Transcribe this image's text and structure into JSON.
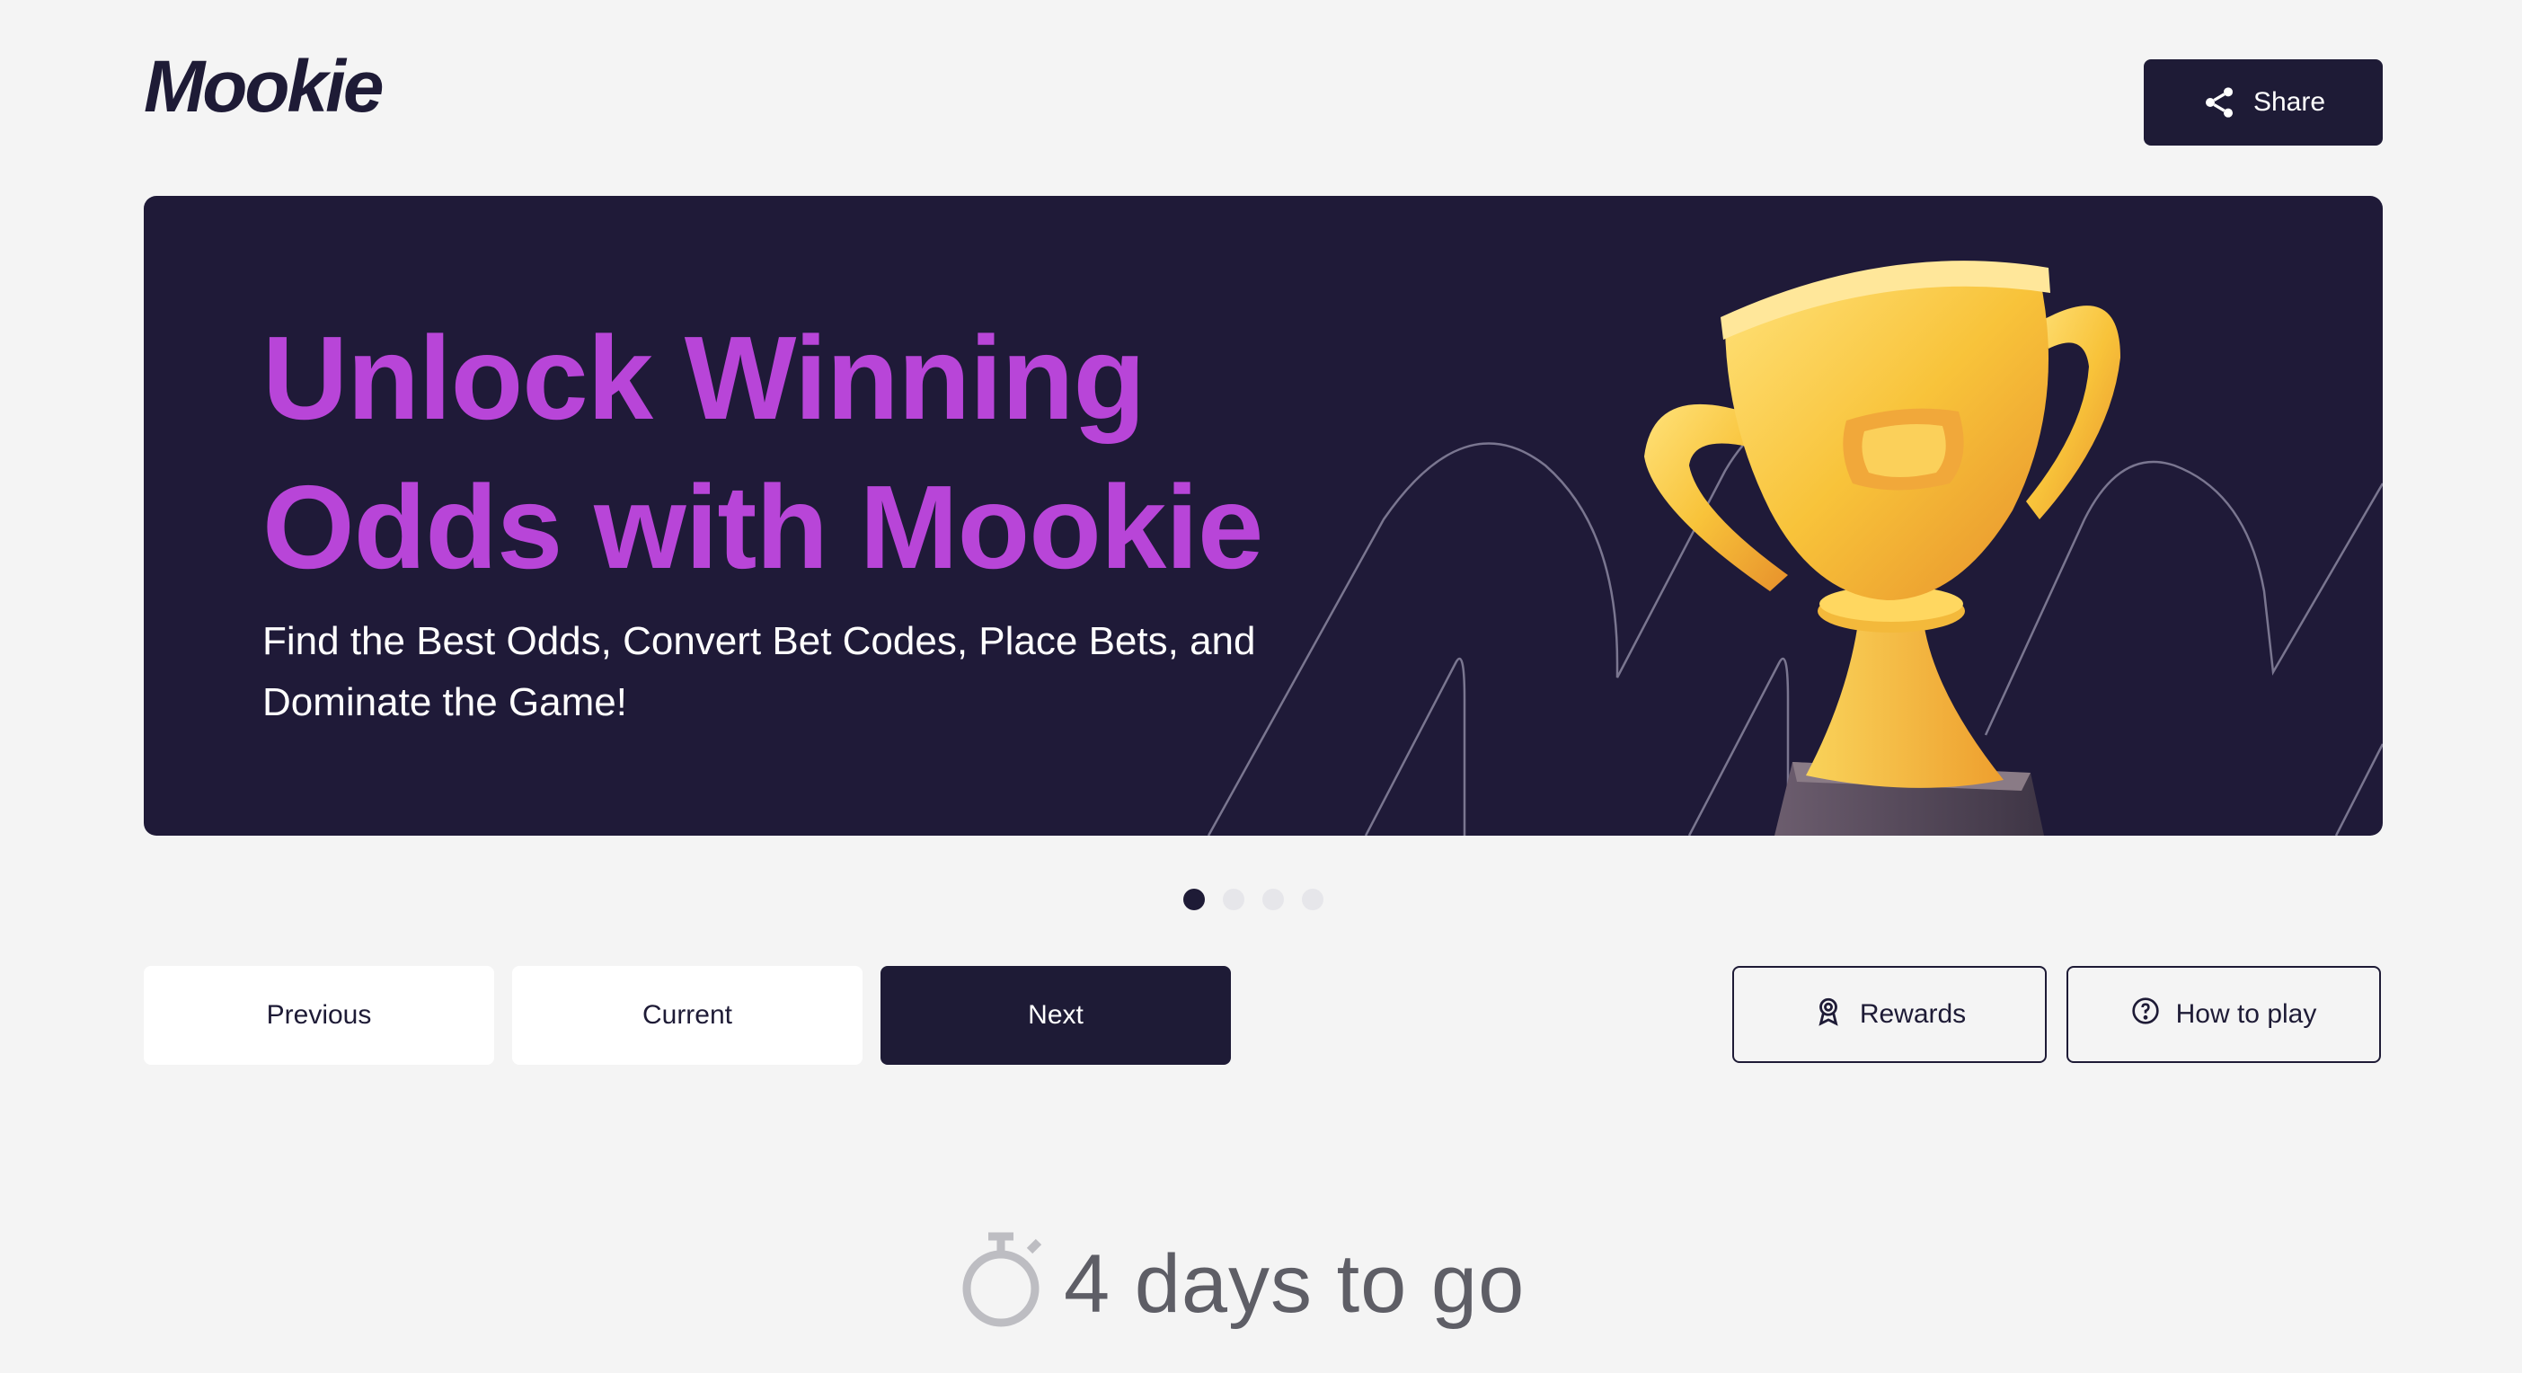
{
  "header": {
    "logo_text": "Mookie",
    "share_label": "Share",
    "share_icon": "share-icon"
  },
  "banner": {
    "title": "Unlock Winning Odds with Mookie",
    "subtitle": "Find the Best Odds, Convert Bet Codes, Place Bets, and Dominate the Game!",
    "image": "trophy-illustration",
    "colors": {
      "background": "#1f1a38",
      "title": "#b845d8",
      "subtitle": "#ffffff"
    }
  },
  "carousel": {
    "total_slides": 4,
    "active_slide": 1
  },
  "tabs": [
    {
      "label": "Previous",
      "active": false
    },
    {
      "label": "Current",
      "active": false
    },
    {
      "label": "Next",
      "active": true
    }
  ],
  "actions": {
    "rewards_label": "Rewards",
    "rewards_icon": "award-icon",
    "how_to_play_label": "How to play",
    "how_to_play_icon": "help-circle-icon"
  },
  "countdown": {
    "icon": "stopwatch-icon",
    "text": "4 days to go"
  },
  "colors": {
    "primary": "#1e1b36",
    "accent": "#b845d8",
    "page_background": "#f4f4f4"
  }
}
